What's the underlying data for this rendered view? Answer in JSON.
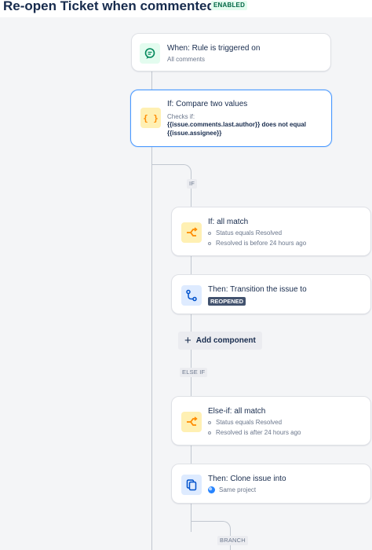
{
  "header": {
    "title": "Re-open Ticket when commented",
    "status": "ENABLED"
  },
  "trigger": {
    "icon": "comment-icon",
    "title": "When: Rule is triggered on",
    "subtitle": "All comments"
  },
  "condition": {
    "icon": "braces-icon",
    "title": "If: Compare two values",
    "checks_label": "Checks if:",
    "line1": "{{issue.comments.last.author}} does not equal",
    "line2": "{{issue.assignee}}"
  },
  "branch_if": {
    "label": "IF",
    "block": {
      "icon": "branch-icon",
      "title": "If: all match",
      "items": [
        "Status equals Resolved",
        "Resolved is before 24 hours ago"
      ]
    },
    "action": {
      "icon": "transition-icon",
      "title": "Then: Transition the issue to",
      "status": "REOPENED"
    }
  },
  "add_component": "Add component",
  "branch_elseif": {
    "label": "ELSE IF",
    "block": {
      "icon": "branch-icon",
      "title": "Else-if: all match",
      "items": [
        "Status equals Resolved",
        "Resolved is after 24 hours ago"
      ]
    },
    "action": {
      "icon": "clone-icon",
      "title": "Then: Clone issue into",
      "project": "Same project"
    }
  },
  "branch_label": "BRANCH",
  "colors": {
    "accent": "#4c9aff",
    "enabled_bg": "#e3fcef",
    "enabled_text": "#006644",
    "status_lozenge": "#42526e"
  }
}
